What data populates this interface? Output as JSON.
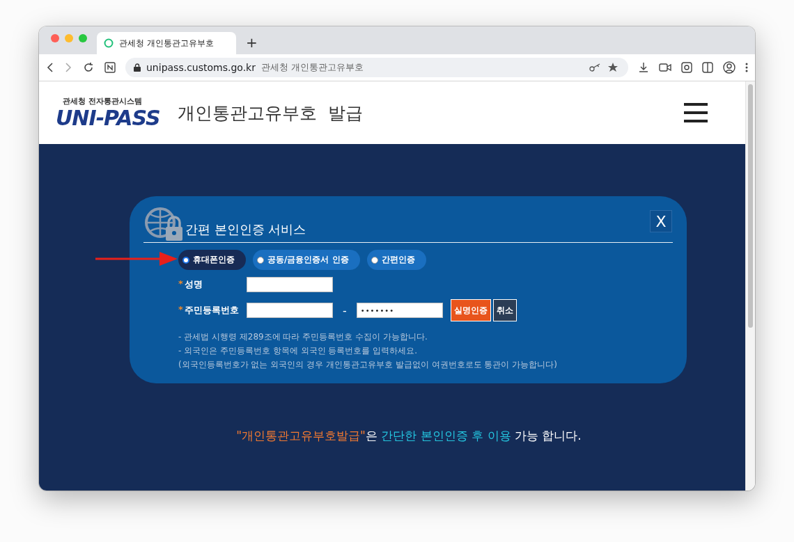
{
  "browser": {
    "tab_title": "관세청 개인통관고유부호",
    "new_tab": "+",
    "url": "unipass.customs.go.kr",
    "page_title": "관세청 개인통관고유부호"
  },
  "header": {
    "logo_caption": "관세청 전자통관시스템",
    "logo_text": "UNI-PASS",
    "title": "개인통관고유부호  발급"
  },
  "dialog": {
    "title": "간편 본인인증 서비스",
    "close": "X",
    "methods": [
      {
        "label": "휴대폰인증",
        "selected": true
      },
      {
        "label": "공동/금융인증서 인증",
        "selected": false
      },
      {
        "label": "간편인증",
        "selected": false
      }
    ],
    "fields": [
      {
        "required_mark": "*",
        "label": "성명",
        "kind": "single"
      },
      {
        "required_mark": "*",
        "label": "주민등록번호",
        "kind": "split",
        "separator": "-",
        "second_value": "• • • • • • •"
      }
    ],
    "buttons": [
      {
        "label": "실명인증",
        "kind": "primary"
      },
      {
        "label": "취소",
        "kind": "secondary"
      }
    ],
    "notes": [
      "- 관세법 시행령 제289조에 따라 주민등록번호 수집이 가능합니다.",
      "- 외국인은 주민등록번호 항목에 외국인 등록번호를 입력하세요.",
      "(외국인등록번호가 없는 외국인의 경우 개인통관고유부호 발급없이 여권번호로도 통관이 가능합니다)"
    ]
  },
  "message": [
    {
      "text": "\"개인통관고유부호발급\"",
      "color": "#f47a30"
    },
    {
      "text": "은 ",
      "color": "#ffffff"
    },
    {
      "text": "간단한 본인인증 후 이용",
      "color": "#24c6e0"
    },
    {
      "text": " 가능 합니다.",
      "color": "#ffffff"
    }
  ]
}
